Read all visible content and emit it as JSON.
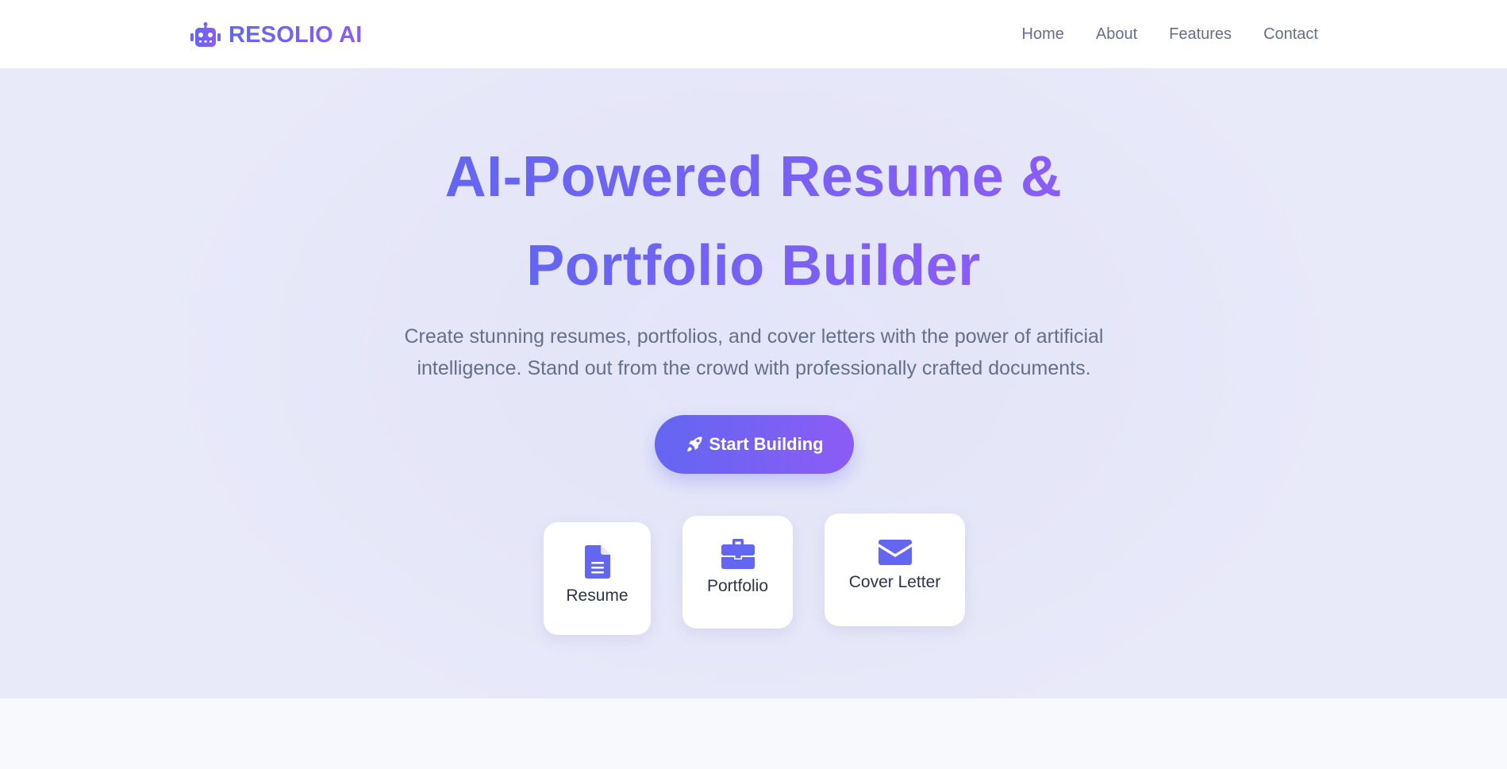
{
  "header": {
    "brand_icon": "robot-icon",
    "brand_name": "RESOLIO AI",
    "nav": [
      {
        "label": "Home"
      },
      {
        "label": "About"
      },
      {
        "label": "Features"
      },
      {
        "label": "Contact"
      }
    ]
  },
  "hero": {
    "title_line1": "AI-Powered Resume &",
    "title_line2": "Portfolio Builder",
    "subtitle": "Create stunning resumes, portfolios, and cover letters with the power of artificial intelligence. Stand out from the crowd with professionally crafted documents.",
    "cta_icon": "rocket-icon",
    "cta_label": "Start Building",
    "cards": [
      {
        "icon": "document-icon",
        "label": "Resume"
      },
      {
        "icon": "briefcase-icon",
        "label": "Portfolio"
      },
      {
        "icon": "envelope-icon",
        "label": "Cover Letter"
      }
    ]
  },
  "colors": {
    "accent_start": "#6366f1",
    "accent_end": "#8b5cf6",
    "nav_text": "#64708a",
    "hero_bg": "#e6e7f9",
    "card_text": "#2d3445"
  }
}
